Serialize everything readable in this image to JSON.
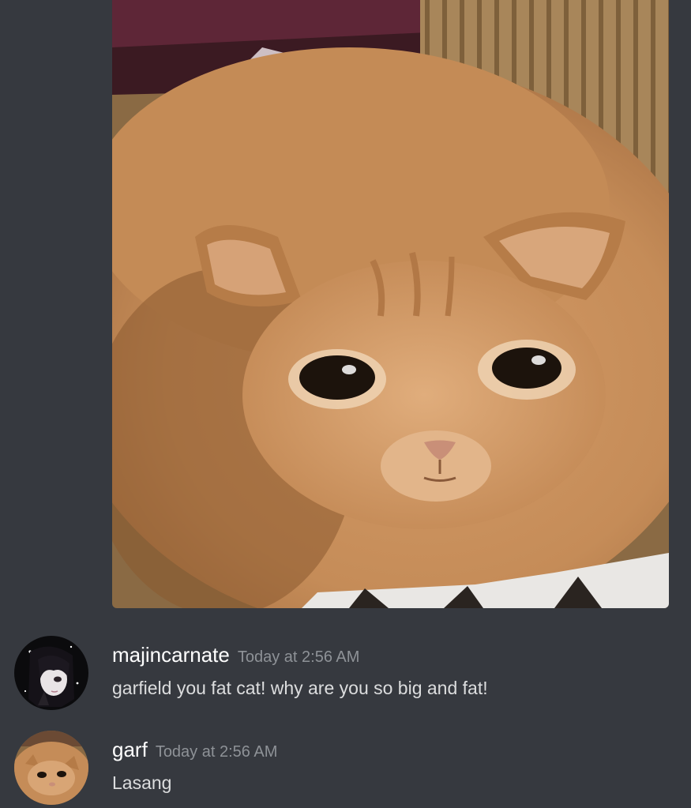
{
  "attachment": {
    "icon": "cat-photo",
    "colors": {
      "fur": "#c58c58",
      "background_fabric": "#a9875a",
      "blanket_top": "#6a2a3c"
    }
  },
  "messages": [
    {
      "username": "majincarnate",
      "timestamp": "Today at 2:56 AM",
      "content": "garfield you fat cat! why are you so big and fat!",
      "avatar": "anime-girl-avatar"
    },
    {
      "username": "garf",
      "timestamp": "Today at 2:56 AM",
      "content": "Lasang",
      "avatar": "cat-avatar"
    }
  ],
  "theme": {
    "background": "#36393f",
    "username_color": "#ffffff",
    "timestamp_color": "#8e9297",
    "text_color": "#dcddde"
  }
}
